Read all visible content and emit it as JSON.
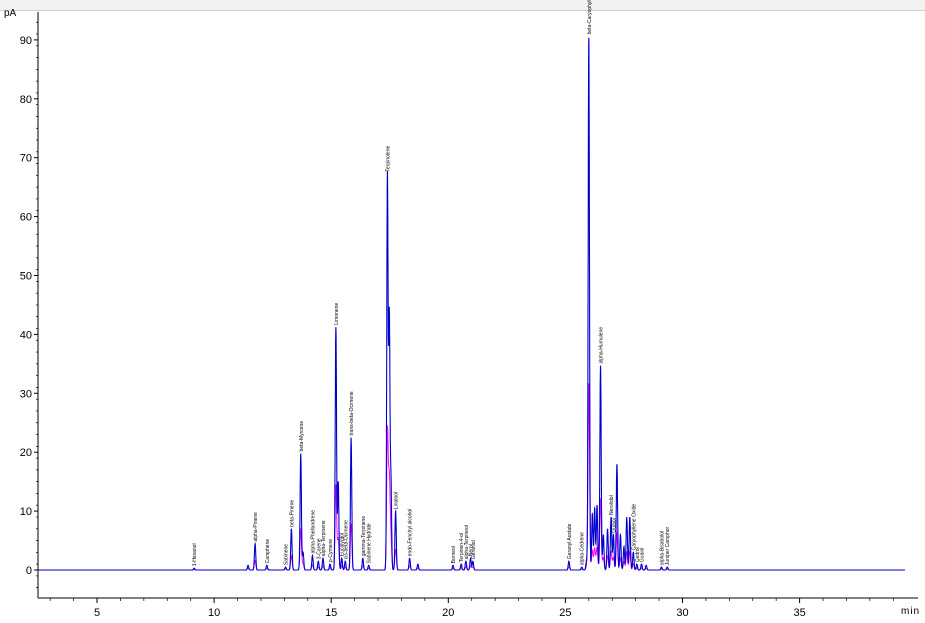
{
  "chart_data": {
    "type": "line",
    "ylabel": "pA",
    "xlabel": "min",
    "xlim": [
      2.5,
      39.5
    ],
    "ylim": [
      -5,
      95
    ],
    "x_ticks": [
      5,
      10,
      15,
      20,
      25,
      30,
      35
    ],
    "y_ticks": [
      0,
      10,
      20,
      30,
      40,
      50,
      60,
      70,
      80,
      90
    ],
    "series": [
      {
        "color": "#0000cc",
        "baseline": 0.0
      },
      {
        "color": "#ff00ff",
        "baseline": 0.0
      }
    ],
    "peaks": [
      {
        "rt": 9.15,
        "height": 0.3,
        "label": "1-Hexanol"
      },
      {
        "rt": 11.45,
        "height": 0.8,
        "label": ""
      },
      {
        "rt": 11.75,
        "height": 4.5,
        "label": "alpha-Pinene"
      },
      {
        "rt": 12.25,
        "height": 0.8,
        "label": "Camphene"
      },
      {
        "rt": 13.05,
        "height": 0.5,
        "label": "Sabinene"
      },
      {
        "rt": 13.3,
        "height": 7.0,
        "label": "beta-Pinene"
      },
      {
        "rt": 13.7,
        "height": 19.8,
        "label": "beta-Myrcene"
      },
      {
        "rt": 13.8,
        "height": 3.0,
        "label": ""
      },
      {
        "rt": 14.2,
        "height": 2.5,
        "label": "alpha-Phellandrene"
      },
      {
        "rt": 14.45,
        "height": 1.5,
        "label": "3-Carene"
      },
      {
        "rt": 14.65,
        "height": 2.0,
        "label": "alpha-Terpinene"
      },
      {
        "rt": 14.95,
        "height": 1.0,
        "label": "p-Cymene"
      },
      {
        "rt": 15.2,
        "height": 41.3,
        "label": "Limonene"
      },
      {
        "rt": 15.3,
        "height": 15.0,
        "label": ""
      },
      {
        "rt": 15.45,
        "height": 2.0,
        "label": "Eucalyptol"
      },
      {
        "rt": 15.6,
        "height": 1.5,
        "label": "cis-beta-Ocimene"
      },
      {
        "rt": 15.85,
        "height": 22.5,
        "label": "trans-beta-Ocimene"
      },
      {
        "rt": 16.35,
        "height": 2.0,
        "label": "gamma-Terpinene"
      },
      {
        "rt": 16.6,
        "height": 0.8,
        "label": "Sabinene Hydrate"
      },
      {
        "rt": 17.4,
        "height": 67.3,
        "label": "Terpinolene"
      },
      {
        "rt": 17.48,
        "height": 43.0,
        "label": ""
      },
      {
        "rt": 17.55,
        "height": 15.0,
        "label": ""
      },
      {
        "rt": 17.75,
        "height": 10.0,
        "label": "Linalool"
      },
      {
        "rt": 18.35,
        "height": 2.0,
        "label": "endo-Fenchyl alcohol"
      },
      {
        "rt": 18.7,
        "height": 1.0,
        "label": ""
      },
      {
        "rt": 20.2,
        "height": 0.8,
        "label": "Borneol"
      },
      {
        "rt": 20.55,
        "height": 1.0,
        "label": "Terpinen-4-ol"
      },
      {
        "rt": 20.75,
        "height": 1.5,
        "label": "alpha-Terpineol"
      },
      {
        "rt": 20.95,
        "height": 2.0,
        "label": "Nerol"
      },
      {
        "rt": 21.05,
        "height": 1.5,
        "label": "Geraniol"
      },
      {
        "rt": 25.15,
        "height": 1.5,
        "label": "Geranyl Acetate"
      },
      {
        "rt": 25.7,
        "height": 0.5,
        "label": "alpha-Cedrene"
      },
      {
        "rt": 25.9,
        "height": 1.5,
        "label": ""
      },
      {
        "rt": 26.0,
        "height": 90.6,
        "label": "beta-Caryophyllene"
      },
      {
        "rt": 26.15,
        "height": 9.5,
        "label": ""
      },
      {
        "rt": 26.25,
        "height": 10.5,
        "label": ""
      },
      {
        "rt": 26.35,
        "height": 11.0,
        "label": ""
      },
      {
        "rt": 26.5,
        "height": 34.7,
        "label": "alpha-Humulene"
      },
      {
        "rt": 26.62,
        "height": 6.0,
        "label": ""
      },
      {
        "rt": 26.8,
        "height": 7.0,
        "label": ""
      },
      {
        "rt": 26.95,
        "height": 9.0,
        "label": "Nerolidol"
      },
      {
        "rt": 27.05,
        "height": 6.0,
        "label": "Guaiol"
      },
      {
        "rt": 27.2,
        "height": 18.0,
        "label": ""
      },
      {
        "rt": 27.35,
        "height": 6.0,
        "label": ""
      },
      {
        "rt": 27.5,
        "height": 4.0,
        "label": ""
      },
      {
        "rt": 27.62,
        "height": 9.0,
        "label": ""
      },
      {
        "rt": 27.75,
        "height": 9.0,
        "label": ""
      },
      {
        "rt": 27.9,
        "height": 3.0,
        "label": "Caryophyllene Oxide"
      },
      {
        "rt": 28.05,
        "height": 1.0,
        "label": "Cedrol"
      },
      {
        "rt": 28.25,
        "height": 1.0,
        "label": "Guaiol"
      },
      {
        "rt": 28.45,
        "height": 0.8,
        "label": ""
      },
      {
        "rt": 29.1,
        "height": 0.5,
        "label": "alpha-Bisabolol"
      },
      {
        "rt": 29.35,
        "height": 0.5,
        "label": "Juniper Camphor"
      }
    ]
  }
}
